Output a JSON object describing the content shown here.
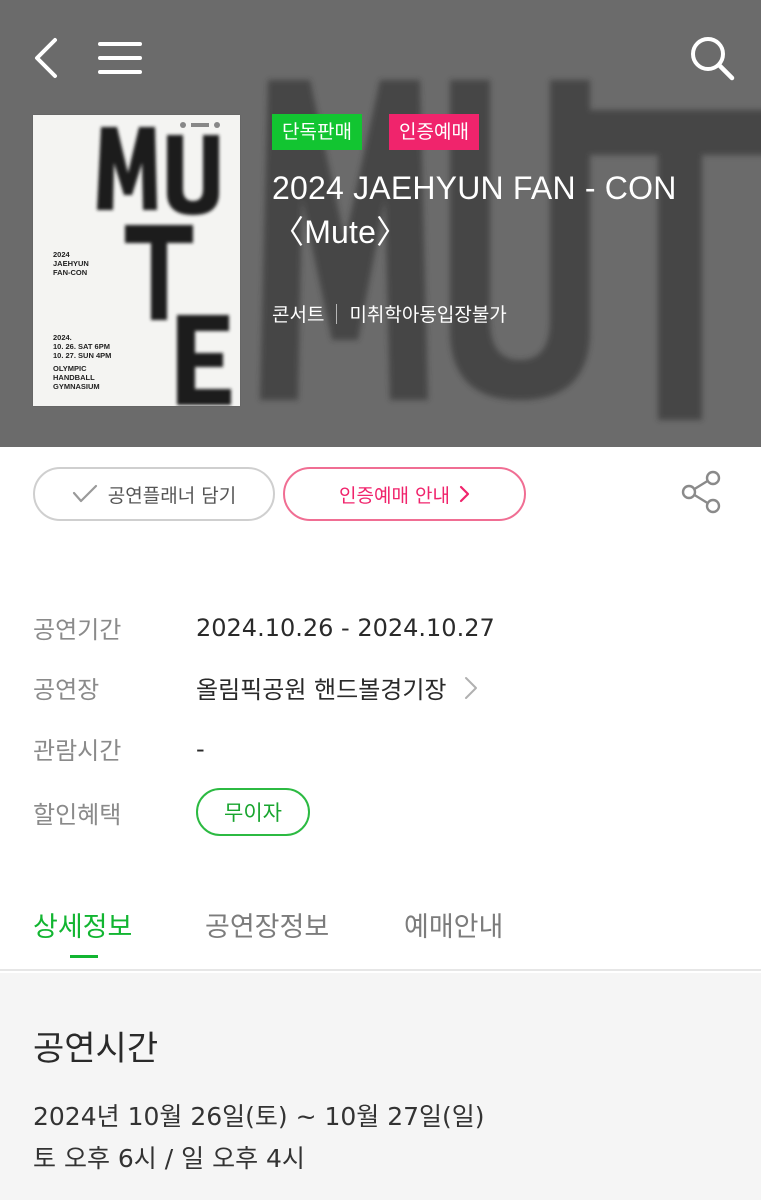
{
  "nav": {
    "back_icon": "chevron-left-icon",
    "menu_icon": "hamburger-menu-icon",
    "search_icon": "search-icon"
  },
  "poster": {
    "title_text": "2024\nJAEHYUN\nFAN-CON",
    "dates_text": "2024.\n10. 26. SAT 6PM\n10. 27. SUN 4PM",
    "venue_text": "OLYMPIC\nHANDBALL\nGYMNASIUM",
    "big_letters": "MUTE"
  },
  "badges": {
    "exclusive": "단독판매",
    "verified": "인증예매"
  },
  "show": {
    "title": "2024 JAEHYUN FAN - CON 〈Mute〉",
    "genre": "콘서트",
    "age_rating": "미취학아동입장불가"
  },
  "actions": {
    "planner_label": "공연플래너 담기",
    "verify_label": "인증예매 안내",
    "share_icon": "share-icon"
  },
  "info": {
    "period_label": "공연기간",
    "period_value": "2024.10.26 - 2024.10.27",
    "venue_label": "공연장",
    "venue_value": "올림픽공원 핸드볼경기장",
    "duration_label": "관람시간",
    "duration_value": "-",
    "discount_label": "할인혜택",
    "discount_value": "무이자"
  },
  "tabs": {
    "detail": "상세정보",
    "venue": "공연장정보",
    "booking": "예매안내"
  },
  "content": {
    "section_title": "공연시간",
    "line1": "2024년 10월 26일(토) ~ 10월 27일(일)",
    "line2": "토 오후 6시 / 일 오후 4시"
  },
  "colors": {
    "brand_green": "#12c531",
    "brand_pink": "#f0246c",
    "hero_gray": "#7a7a7a"
  }
}
